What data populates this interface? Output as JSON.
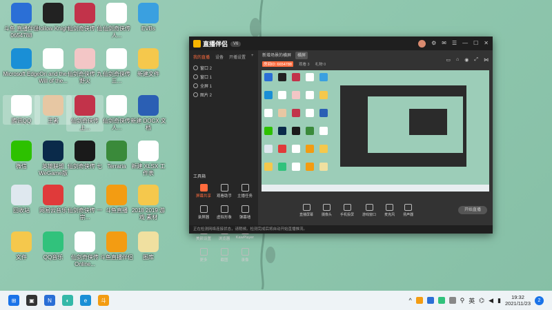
{
  "desktop": {
    "col1": [
      {
        "label": "斗鱼 直播伴侣 0654788",
        "color": "#2b6fd6",
        "icon": "douyu-icon"
      },
      {
        "label": "Microsoft Edge",
        "color": "#1a8fd6",
        "icon": "edge-icon"
      },
      {
        "label": "腾讯QQ",
        "color": "#ffffff",
        "icon": "qq-icon"
      },
      {
        "label": "微信",
        "color": "#2dc100",
        "icon": "wechat-icon"
      },
      {
        "label": "回收站",
        "color": "#dfe8ef",
        "icon": "recycle-bin-icon"
      },
      {
        "label": "文件",
        "color": "#f5c84c",
        "icon": "folder-icon"
      }
    ],
    "col2": [
      {
        "label": "Hollow Knight",
        "color": "#222222",
        "icon": "hollow-knight-icon"
      },
      {
        "label": "Ori and the Will of the...",
        "color": "#ffffff",
        "icon": "ori-icon"
      },
      {
        "label": "王者",
        "color": "#e7c7a3",
        "icon": "game-icon"
      },
      {
        "label": "英雄联盟 WeGame版",
        "color": "#0a2a4a",
        "icon": "lol-icon"
      },
      {
        "label": "网易云音乐",
        "color": "#e03a3a",
        "icon": "netease-music-icon"
      },
      {
        "label": "QQ音乐",
        "color": "#31c27c",
        "icon": "qqmusic-icon"
      }
    ],
    "col3": [
      {
        "label": "仙剑奇侠传 仙",
        "color": "#c2334a",
        "icon": "xianjian-icon"
      },
      {
        "label": "仙剑奇侠传 九 野火",
        "color": "#f3c6c6",
        "icon": "xianjian-icon"
      },
      {
        "label": "仙剑奇侠传 上...",
        "color": "#c2334a",
        "icon": "xianjian-icon"
      },
      {
        "label": "仙剑奇侠传 七",
        "color": "#1a1a1a",
        "icon": "xianjian-icon"
      },
      {
        "label": "仙剑奇侠传 一 宗...",
        "color": "#ffffff",
        "icon": "xianjian-icon"
      },
      {
        "label": "仙剑奇侠传 Online...",
        "color": "#ffffff",
        "icon": "document-icon"
      }
    ],
    "col4": [
      {
        "label": "仙剑奇侠传 人...",
        "color": "#ffffff",
        "icon": "document-icon"
      },
      {
        "label": "仙剑奇侠传 三...",
        "color": "#ffffff",
        "icon": "document-icon"
      },
      {
        "label": "仙剑奇侠传 人...",
        "color": "#ffffff",
        "icon": "document-icon"
      },
      {
        "label": "Terraria",
        "color": "#3a8a3a",
        "icon": "terraria-icon"
      },
      {
        "label": "斗鱼直播",
        "color": "#f39c12",
        "icon": "douyu-icon"
      },
      {
        "label": "斗鱼直播伴侣",
        "color": "#f39c12",
        "icon": "douyu-icon"
      }
    ],
    "col5": [
      {
        "label": "EVBs",
        "color": "#3aa0e0",
        "icon": "app-icon"
      },
      {
        "label": "新建文件",
        "color": "#f5c84c",
        "icon": "folder-icon"
      },
      {
        "label": "新建 DOCX 文档",
        "color": "#2b5fb4",
        "icon": "word-icon"
      },
      {
        "label": "新建 XLSX 工作表",
        "color": "#ffffff",
        "icon": "excel-icon"
      },
      {
        "label": "2018 2019 游戏 素材",
        "color": "#f5c84c",
        "icon": "folder-icon"
      },
      {
        "label": "图库",
        "color": "#f0e0a0",
        "icon": "gallery-icon"
      }
    ]
  },
  "app": {
    "brand": "直播伴侣",
    "version": "V6",
    "tabs": [
      "我的直播",
      "设备",
      "开播设置"
    ],
    "layers": [
      "窗口 2",
      "窗口 1",
      "全屏 1",
      "图片 2"
    ],
    "room_title": "新增场景的横屏",
    "room_tag": "横屏",
    "stats": [
      "房间ID: 6654788",
      "观看 3",
      "礼物 0"
    ],
    "toolbox_title": "工具箱",
    "tools": [
      {
        "label": "屏幕共享",
        "hot": true
      },
      {
        "label": "观看助手",
        "hot": false
      },
      {
        "label": "主播任务",
        "hot": false
      },
      {
        "label": "录屏器",
        "hot": false
      },
      {
        "label": "虚拟形象",
        "hot": false
      },
      {
        "label": "弹幕墙",
        "hot": false
      },
      {
        "label": "美颜设置",
        "hot": false
      },
      {
        "label": "浏览器",
        "hot": false
      },
      {
        "label": "KawPlayer",
        "hot": false
      },
      {
        "label": "更多",
        "hot": false
      },
      {
        "label": "截图",
        "hot": false
      },
      {
        "label": "录像",
        "hot": false
      }
    ],
    "bottom_buttons": [
      "直播屏幕",
      "摄像头",
      "手机投屏",
      "游戏窗口",
      "麦克风",
      "扬声器"
    ],
    "start_live": "开始直播",
    "status": "正在检测网络连接状态，请稍候。检测完成后将自动开始直播推流。"
  },
  "taskbar": {
    "ime": "英",
    "time": "19:32",
    "date": "2021/11/23",
    "notifications": "2"
  }
}
